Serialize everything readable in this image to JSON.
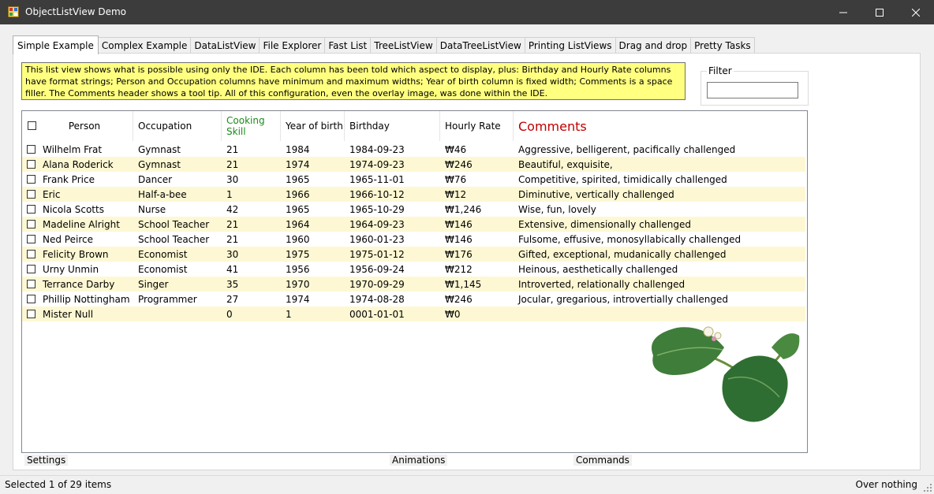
{
  "window": {
    "title": "ObjectListView Demo"
  },
  "tabs": [
    "Simple Example",
    "Complex Example",
    "DataListView",
    "File Explorer",
    "Fast List",
    "TreeListView",
    "DataTreeListView",
    "Printing ListViews",
    "Drag and drop",
    "Pretty Tasks"
  ],
  "description": "This list view shows what is possible using only the IDE. Each column has been told which aspect to display, plus: Birthday and Hourly Rate columns have format strings; Person and Occupation columns have minimum and maximum widths; Year of birth column is fixed width; Comments is a space filler. The Comments header shows a tool tip. All of this configuration, even the overlay image, was done within the IDE.",
  "filter": {
    "label": "Filter",
    "value": ""
  },
  "columns": [
    "Person",
    "Occupation",
    "Cooking Skill",
    "Year of birth",
    "Birthday",
    "Hourly Rate",
    "Comments"
  ],
  "rows": [
    [
      "Wilhelm Frat",
      "Gymnast",
      "21",
      "1984",
      "1984-09-23",
      "₩46",
      "Aggressive, belligerent, pacifically challenged"
    ],
    [
      "Alana Roderick",
      "Gymnast",
      "21",
      "1974",
      "1974-09-23",
      "₩246",
      "Beautiful, exquisite,"
    ],
    [
      "Frank Price",
      "Dancer",
      "30",
      "1965",
      "1965-11-01",
      "₩76",
      "Competitive, spirited, timidically challenged"
    ],
    [
      "Eric",
      "Half-a-bee",
      "1",
      "1966",
      "1966-10-12",
      "₩12",
      "Diminutive, vertically challenged"
    ],
    [
      "Nicola Scotts",
      "Nurse",
      "42",
      "1965",
      "1965-10-29",
      "₩1,246",
      "Wise, fun, lovely"
    ],
    [
      "Madeline Alright",
      "School Teacher",
      "21",
      "1964",
      "1964-09-23",
      "₩146",
      "Extensive, dimensionally challenged"
    ],
    [
      "Ned Peirce",
      "School Teacher",
      "21",
      "1960",
      "1960-01-23",
      "₩146",
      "Fulsome, effusive, monosyllabically challenged"
    ],
    [
      "Felicity Brown",
      "Economist",
      "30",
      "1975",
      "1975-01-12",
      "₩176",
      "Gifted, exceptional, mudanically challenged"
    ],
    [
      "Urny Unmin",
      "Economist",
      "41",
      "1956",
      "1956-09-24",
      "₩212",
      "Heinous, aesthetically challenged"
    ],
    [
      "Terrance Darby",
      "Singer",
      "35",
      "1970",
      "1970-09-29",
      "₩1,145",
      "Introverted, relationally challenged"
    ],
    [
      "Phillip Nottingham",
      "Programmer",
      "27",
      "1974",
      "1974-08-28",
      "₩246",
      "Jocular, gregarious, introvertially challenged"
    ],
    [
      "Mister Null",
      "",
      "0",
      "1",
      "0001-01-01",
      "₩0",
      ""
    ]
  ],
  "groups": {
    "settings": "Settings",
    "animations": "Animations",
    "commands": "Commands"
  },
  "status": {
    "left": "Selected 1 of 29 items",
    "right": "Over nothing"
  },
  "colors": {
    "titlebar": "#3c3c3c",
    "desc_bg": "#ffff80",
    "alt_row": "#fdf8d3",
    "skill_header": "#1a8a1a",
    "comments_header": "#c00000"
  }
}
